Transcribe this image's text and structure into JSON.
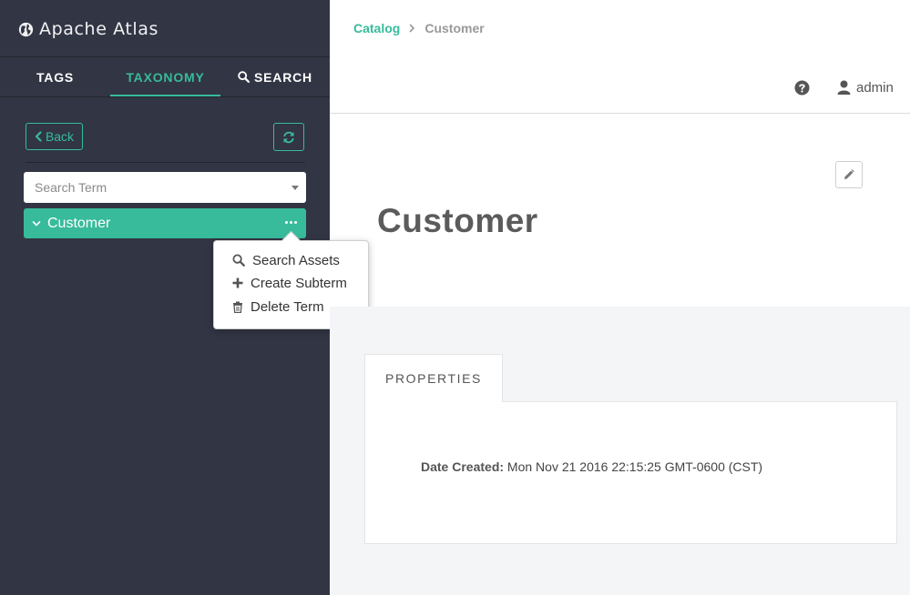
{
  "app": {
    "brand": "Apache Atlas"
  },
  "sidebar": {
    "tabs": [
      {
        "label": "TAGS"
      },
      {
        "label": "TAXONOMY"
      },
      {
        "label": "SEARCH"
      }
    ],
    "back_label": "Back",
    "search_placeholder": "Search Term",
    "term": {
      "label": "Customer"
    },
    "context_menu": [
      {
        "label": "Search Assets",
        "icon": "search-icon"
      },
      {
        "label": "Create Subterm",
        "icon": "plus-icon"
      },
      {
        "label": "Delete Term",
        "icon": "trash-icon"
      }
    ]
  },
  "header": {
    "breadcrumb": {
      "root": "Catalog",
      "current": "Customer"
    },
    "user": "admin"
  },
  "main": {
    "title": "Customer",
    "tab_label": "PROPERTIES",
    "properties": [
      {
        "label": "Date Created:",
        "value": "Mon Nov 21 2016 22:15:25 GMT-0600 (CST)"
      }
    ]
  },
  "colors": {
    "accent": "#37bb9b",
    "sidebar_bg": "#323544",
    "content_bg": "#f4f5f7"
  }
}
